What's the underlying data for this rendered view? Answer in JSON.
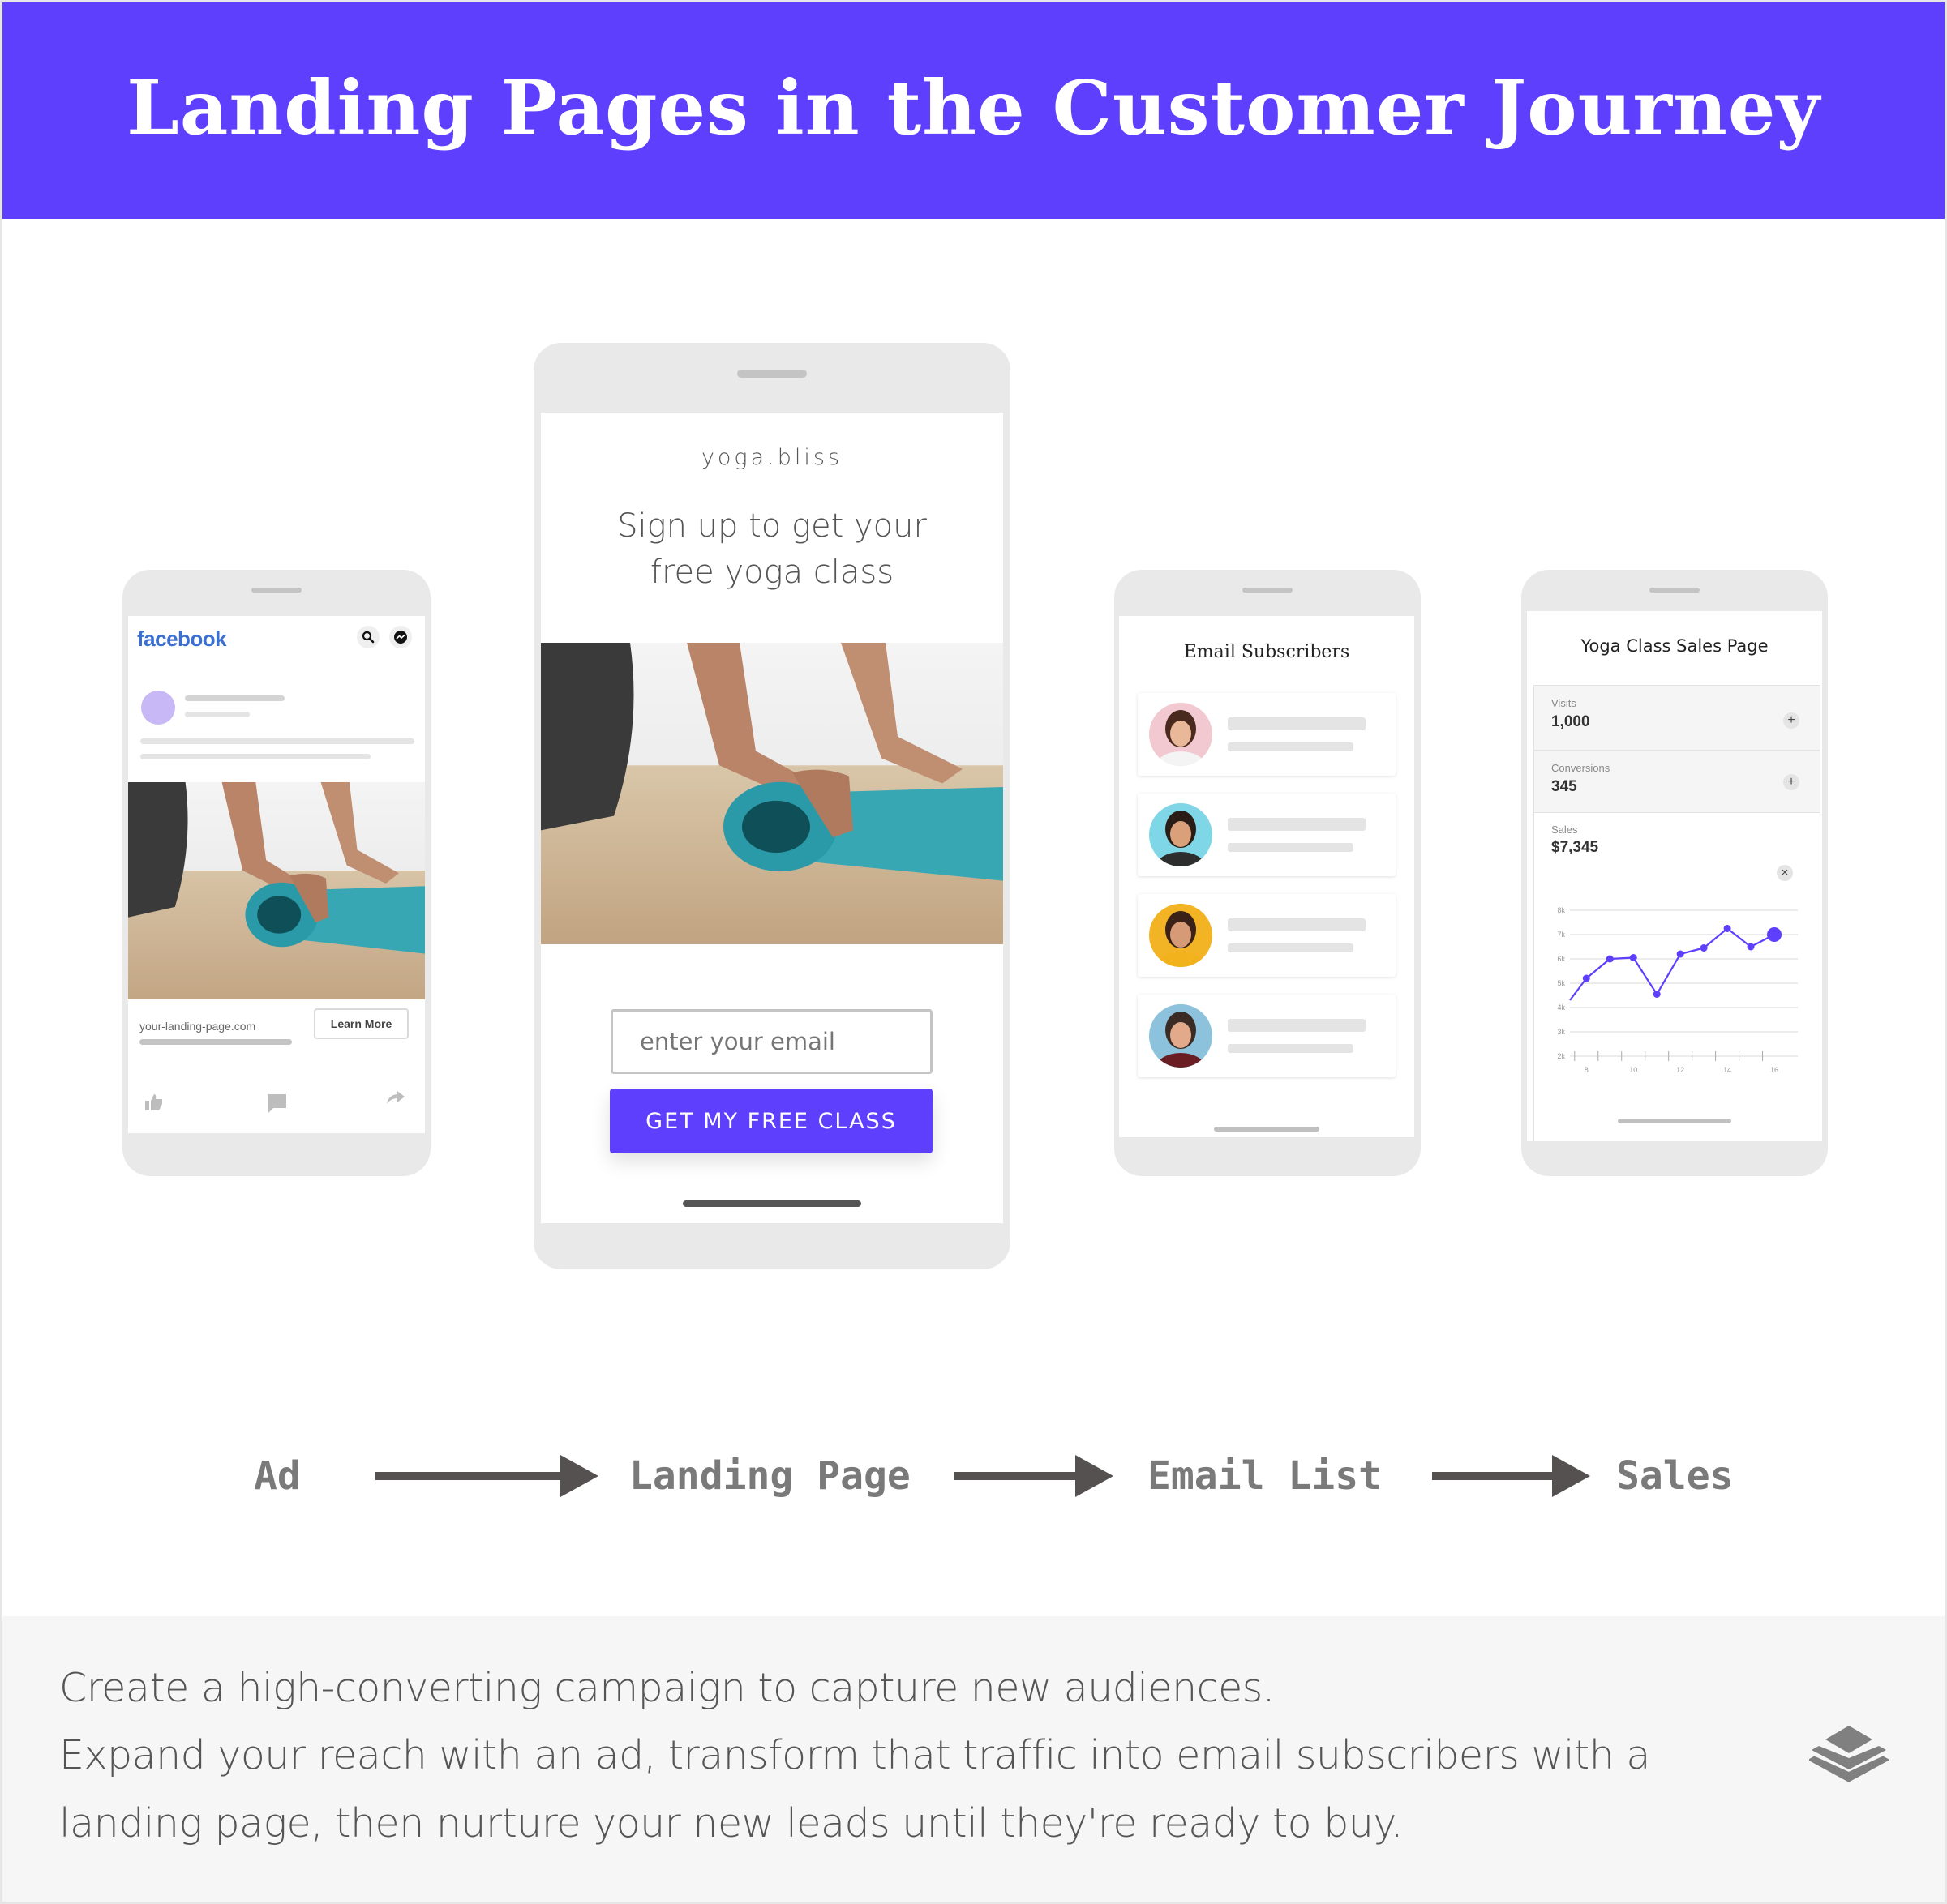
{
  "header": {
    "title": "Landing Pages in the Customer Journey",
    "background": "#5d3ffd"
  },
  "ad_phone": {
    "brand": "facebook",
    "brand_color": "#3b6fd1",
    "icons": [
      "search-icon",
      "messenger-icon"
    ],
    "url": "your-landing-page.com",
    "cta_label": "Learn More",
    "actions": [
      "like-icon",
      "comment-icon",
      "share-icon"
    ]
  },
  "landing_phone": {
    "brand": "yoga.bliss",
    "headline_line1": "Sign up to get your",
    "headline_line2": "free yoga class",
    "email_placeholder": "enter your email",
    "cta_label": "GET MY FREE CLASS",
    "accent": "#5d3ffd"
  },
  "email_phone": {
    "title": "Email Subscribers",
    "subscribers": [
      {
        "avatar_bg": "#f2c9d1",
        "skin": "#e8b898",
        "hair": "#4a2a1e",
        "shirt": "#f4f4f4"
      },
      {
        "avatar_bg": "#7fd6e6",
        "skin": "#d9a07a",
        "hair": "#2a1c16",
        "shirt": "#2d2d2d"
      },
      {
        "avatar_bg": "#f2b324",
        "skin": "#d69a76",
        "hair": "#3a2218",
        "shirt": "#f1b21d"
      },
      {
        "avatar_bg": "#8cc2dc",
        "skin": "#e2a98a",
        "hair": "#3a2c24",
        "shirt": "#6a1e24"
      }
    ]
  },
  "sales_phone": {
    "title": "Yoga Class Sales Page",
    "metrics": [
      {
        "label": "Visits",
        "value": "1,000",
        "action": "+"
      },
      {
        "label": "Conversions",
        "value": "345",
        "action": "+"
      }
    ],
    "sales_label": "Sales",
    "sales_value": "$7,345",
    "close_label": "×"
  },
  "chart_data": {
    "type": "line",
    "title": "Sales",
    "xlabel": "",
    "ylabel": "",
    "x": [
      7.3,
      8,
      9,
      10,
      11,
      12,
      13,
      14,
      15,
      16
    ],
    "values": [
      4300,
      5200,
      6000,
      6050,
      4550,
      6200,
      6450,
      7250,
      6500,
      7000
    ],
    "x_ticks": [
      "8",
      "10",
      "12",
      "14",
      "16"
    ],
    "y_ticks": [
      "2k",
      "3k",
      "4k",
      "5k",
      "6k",
      "7k",
      "8k"
    ],
    "ylim": [
      2000,
      8000
    ],
    "xlim": [
      7.3,
      17
    ],
    "grid": true,
    "color": "#5d3ffd",
    "highlight_last": true
  },
  "flow": {
    "steps": [
      "Ad",
      "Landing Page",
      "Email List",
      "Sales"
    ],
    "arrow_color": "#555150"
  },
  "footer": {
    "line1": "Create a high-converting campaign to capture new audiences.",
    "line2": "Expand your reach with an ad, transform that traffic into email subscribers with a",
    "line3": "landing page, then nurture your new leads until they're ready to buy.",
    "logo": "layers-icon"
  }
}
